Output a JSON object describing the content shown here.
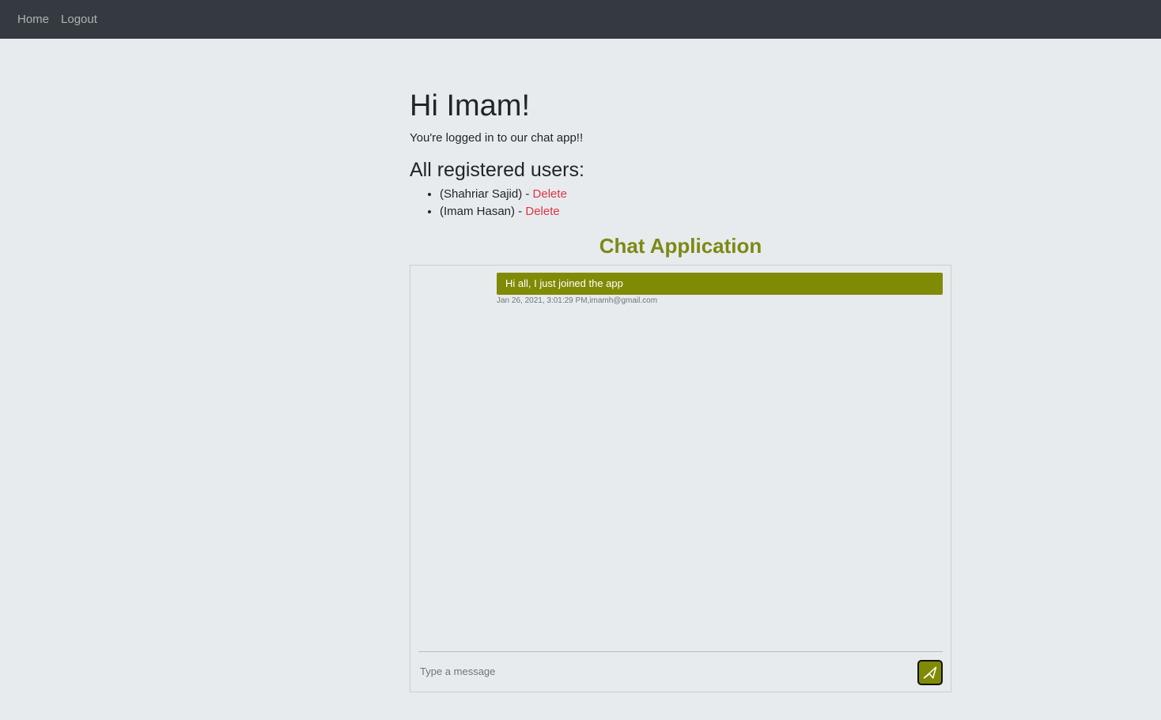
{
  "nav": {
    "home_label": "Home",
    "logout_label": "Logout"
  },
  "main": {
    "greeting": "Hi Imam!",
    "subtext": "You're logged in to our chat app!!",
    "users_title": "All registered users:",
    "users": [
      {
        "name": "(Shahriar Sajid) - ",
        "delete_label": "Delete"
      },
      {
        "name": "(Imam Hasan) - ",
        "delete_label": "Delete"
      }
    ]
  },
  "chat": {
    "title": "Chat Application",
    "messages": [
      {
        "text": "Hi all, I just joined the app",
        "meta": "Jan 26, 2021, 3:01:29 PM,imamh@gmail.com"
      }
    ],
    "input_placeholder": "Type a message",
    "send_icon": "paper-plane-icon"
  },
  "colors": {
    "navbar": "#343a40",
    "accent": "#808b05",
    "title": "#7b8a14",
    "delete": "#dc3545",
    "background": "#e8ebee"
  }
}
